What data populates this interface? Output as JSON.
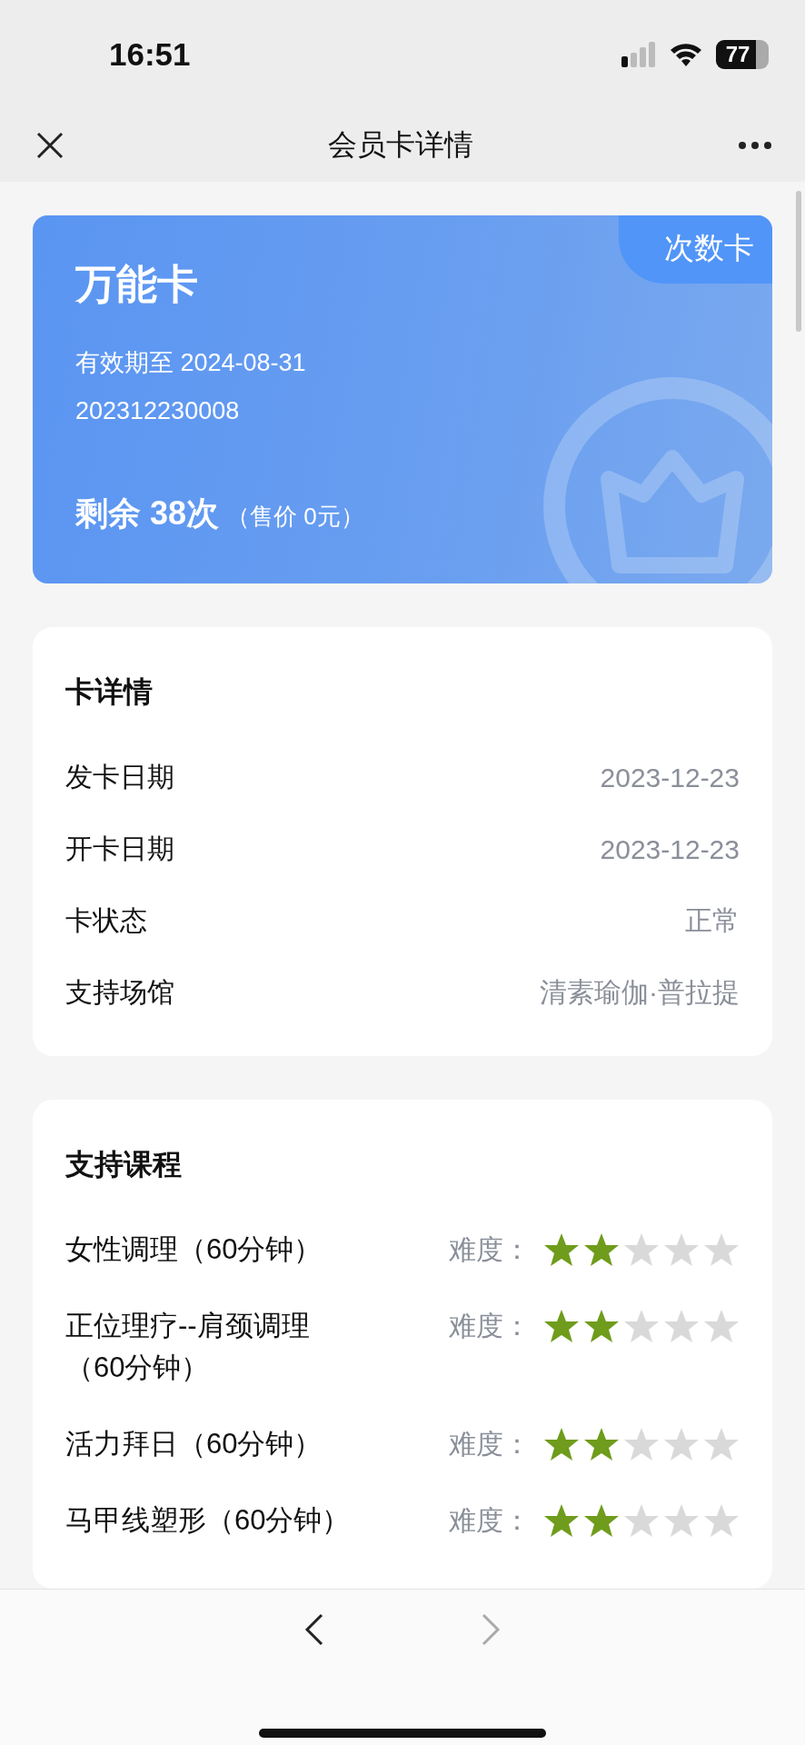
{
  "status_bar": {
    "time": "16:51",
    "battery": "77"
  },
  "nav": {
    "title": "会员卡详情"
  },
  "card": {
    "badge": "次数卡",
    "name": "万能卡",
    "validity": "有效期至 2024-08-31",
    "number": "202312230008",
    "remaining": "剩余 38次",
    "price": "（售价 0元）"
  },
  "details": {
    "title": "卡详情",
    "rows": [
      {
        "label": "发卡日期",
        "value": "2023-12-23"
      },
      {
        "label": "开卡日期",
        "value": "2023-12-23"
      },
      {
        "label": "卡状态",
        "value": "正常"
      },
      {
        "label": "支持场馆",
        "value": "清素瑜伽·普拉提"
      }
    ]
  },
  "courses": {
    "title": "支持课程",
    "rows": [
      {
        "name": "女性调理（60分钟）",
        "difficulty_label": "难度：",
        "stars": 2
      },
      {
        "name": "正位理疗--肩颈调理（60分钟）",
        "difficulty_label": "难度：",
        "stars": 2
      },
      {
        "name": "活力拜日（60分钟）",
        "difficulty_label": "难度：",
        "stars": 2
      },
      {
        "name": "马甲线塑形（60分钟）",
        "difficulty_label": "难度：",
        "stars": 2
      }
    ]
  }
}
